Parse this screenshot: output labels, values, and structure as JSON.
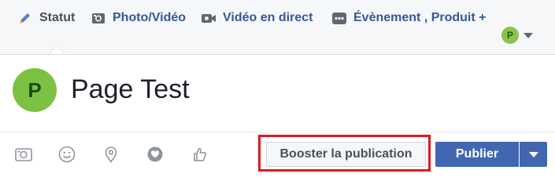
{
  "tabs": [
    {
      "label": "Statut",
      "icon": "pencil-icon"
    },
    {
      "label": "Photo/Vidéo",
      "icon": "camera-icon"
    },
    {
      "label": "Vidéo en direct",
      "icon": "video-camera-icon"
    },
    {
      "label": "Évènement , Produit +",
      "icon": "more-dots-icon"
    }
  ],
  "identity": {
    "avatar_letter": "P"
  },
  "composer": {
    "avatar_letter": "P",
    "text": "Page Test"
  },
  "toolbar": {
    "icons": [
      "camera-icon",
      "smiley-icon",
      "location-pin-icon",
      "heart-badge-icon",
      "thumbs-up-icon"
    ],
    "boost_label": "Booster la publication",
    "publish_label": "Publier"
  },
  "colors": {
    "primary": "#4267b2",
    "link": "#365899",
    "highlight": "#e0191e",
    "avatar": "#7cc242"
  }
}
